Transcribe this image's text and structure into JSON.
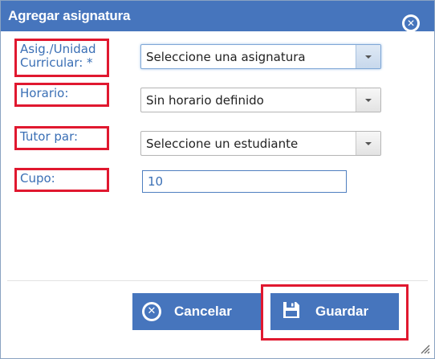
{
  "dialog": {
    "title": "Agregar asignatura",
    "close_icon": "close-circle-icon"
  },
  "form": {
    "asignatura": {
      "label": "Asig./Unidad Curricular: *",
      "label_line1": "Asig./Unidad",
      "label_line2": "Curricular: *",
      "selected": "Seleccione una asignatura"
    },
    "horario": {
      "label": "Horario:",
      "selected": "Sin horario definido"
    },
    "tutor": {
      "label": "Tutor par:",
      "selected": "Seleccione un estudiante"
    },
    "cupo": {
      "label": "Cupo:",
      "value": "10"
    }
  },
  "buttons": {
    "cancel_label": "Cancelar",
    "cancel_icon": "cancel-circle-icon",
    "save_label": "Guardar",
    "save_icon": "floppy-disk-icon"
  },
  "colors": {
    "header": "#4675bd",
    "label_text": "#3a6fb5",
    "highlight": "#e0182f"
  }
}
